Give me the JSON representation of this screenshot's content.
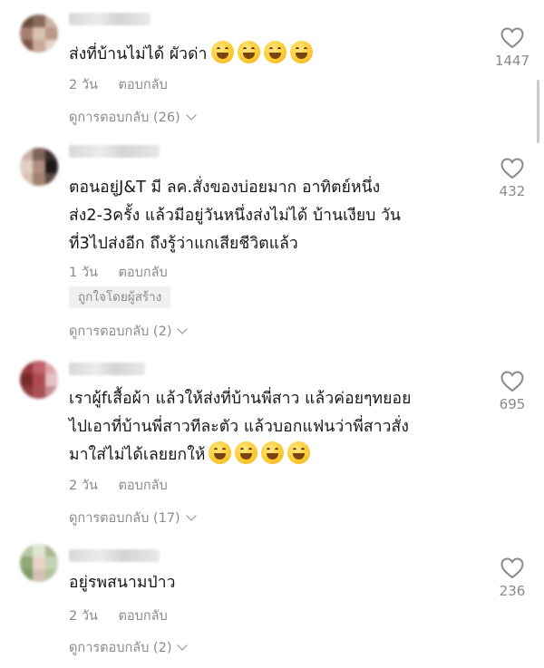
{
  "comments": [
    {
      "text_lines": [
        "ส่งที่บ้านไม่ได้ ผัวด่า"
      ],
      "emoji_count": 4,
      "time": "2 วัน",
      "reply_label": "ตอบกลับ",
      "view_replies": "ดูการตอบกลับ (26)",
      "likes": "1447"
    },
    {
      "text_lines": [
        "ตอนอยู่J&T มี ลค.สั่งของบ่อยมาก อาทิตย์หนึ่ง",
        "ส่ง2-3ครั้ง แล้วมีอยู่วันหนึ่งส่งไม่ได้ บ้านเงียบ วัน",
        "ที่3ไปส่งอีก ถึงรู้ว่าแกเสียชีวิตแล้ว"
      ],
      "emoji_count": 0,
      "time": "1 วัน",
      "reply_label": "ตอบกลับ",
      "creator_badge": "ถูกใจโดยผู้สร้าง",
      "view_replies": "ดูการตอบกลับ (2)",
      "likes": "432"
    },
    {
      "text_lines": [
        "เราผู้fเสื้อผ้า แล้วให้ส่งที่บ้านพี่สาว แล้วค่อยๆทยอย",
        "ไปเอาที่บ้านพี่สาวทีละตัว แล้วบอกแฟนว่าพี่สาวสั่ง",
        "มาใส่ไม่ได้เลยยกให้"
      ],
      "emoji_count": 4,
      "time": "2 วัน",
      "reply_label": "ตอบกลับ",
      "view_replies": "ดูการตอบกลับ (17)",
      "likes": "695"
    },
    {
      "text_lines": [
        "อยู่รพสนามป่าว"
      ],
      "emoji_count": 0,
      "time": "2 วัน",
      "reply_label": "ตอบกลับ",
      "view_replies": "ดูการตอบกลับ (2)",
      "likes": "236"
    }
  ],
  "colors": {
    "text": "#161616",
    "meta": "#8a8a8a",
    "badge_bg": "#f0f0f0"
  },
  "icons": {
    "like": "heart-outline-icon",
    "expand": "chevron-down-icon",
    "reaction": "grinning-squinting-face-emoji"
  }
}
